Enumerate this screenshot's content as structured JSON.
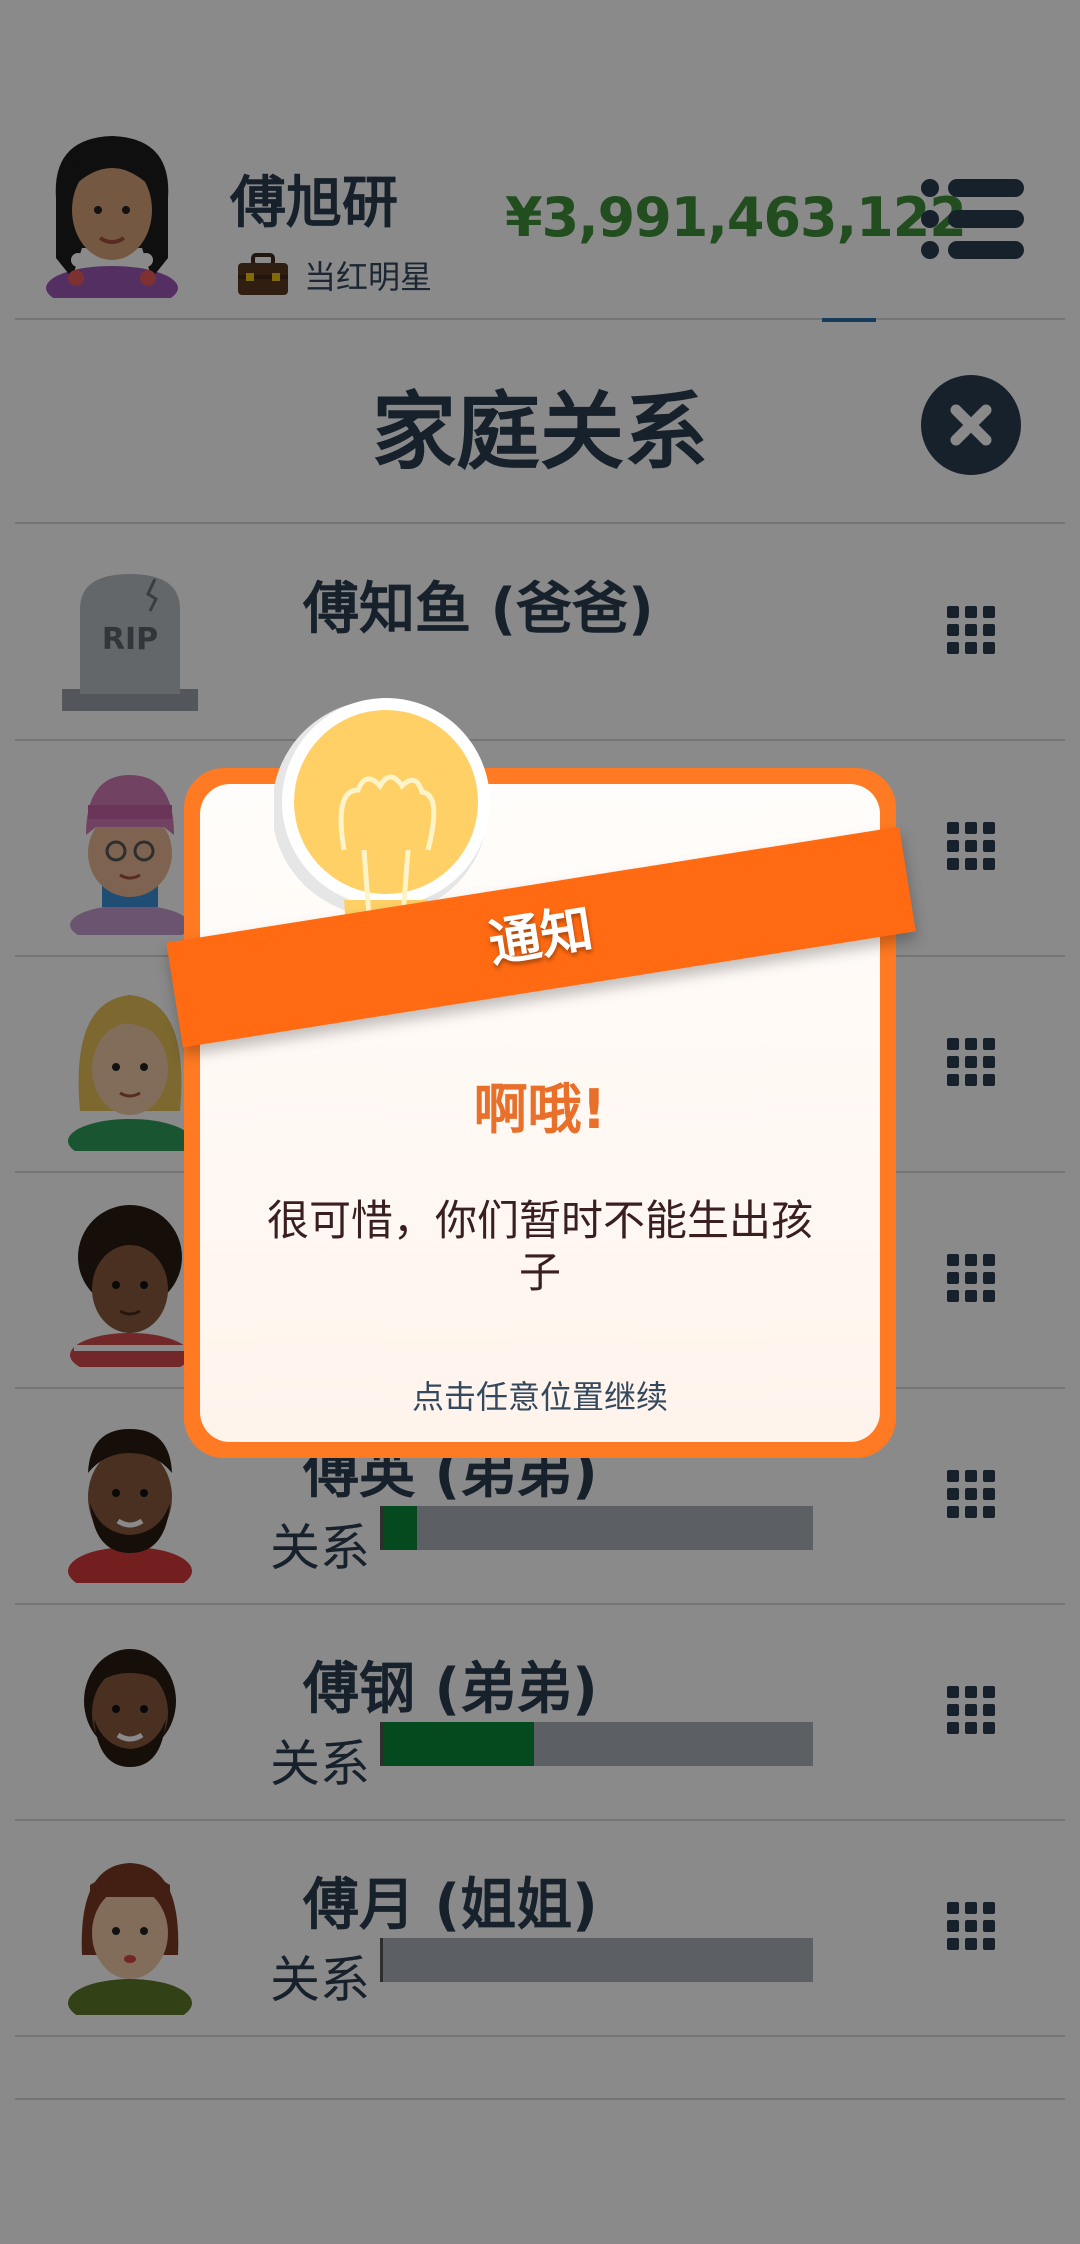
{
  "header": {
    "player_name": "傅旭研",
    "job_label": "当红明星",
    "job_icon": "briefcase-icon",
    "money": "¥3,991,463,122",
    "menu_icon": "menu-list-icon",
    "money_color": "#3f8f3a"
  },
  "family": {
    "title": "家庭关系",
    "close_icon": "close-icon",
    "members": [
      {
        "name": "傅知鱼 (爸爸)",
        "status": "deceased",
        "rip_text": "RIP",
        "relation_label": "",
        "relation_level": null
      },
      {
        "name": "",
        "relation_label": "",
        "relation_level": null
      },
      {
        "name": "",
        "relation_label": "",
        "relation_level": null
      },
      {
        "name": "",
        "relation_label": "",
        "relation_level": null
      },
      {
        "name": "傅英 (弟弟)",
        "relation_label": "关系",
        "relation_level": 0.08
      },
      {
        "name": "傅钢 (弟弟)",
        "relation_label": "关系",
        "relation_level": 0.35
      },
      {
        "name": "傅月 (姐姐)",
        "relation_label": "关系",
        "relation_level": 0.0
      }
    ],
    "row_action_icon": "grid-menu-icon"
  },
  "dialog": {
    "ribbon_label": "通知",
    "heading": "啊哦!",
    "message": "很可惜，你们暂时不能生出孩子",
    "hint": "点击任意位置继续",
    "icon": "lightbulb-icon",
    "accent_color": "#ff6a12"
  }
}
